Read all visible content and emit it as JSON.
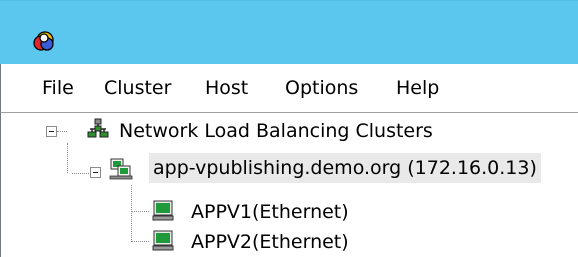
{
  "window": {
    "app_icon": "nlb-manager-icon",
    "titlebar_color": "#5bc7ee"
  },
  "menu": {
    "items": [
      {
        "label": "File"
      },
      {
        "label": "Cluster"
      },
      {
        "label": "Host"
      },
      {
        "label": "Options"
      },
      {
        "label": "Help"
      }
    ]
  },
  "tree": {
    "root": {
      "label": "Network Load Balancing Clusters",
      "icon": "network-clusters-icon",
      "expanded": true
    },
    "cluster": {
      "label": "app-vpublishing.demo.org (172.16.0.13)",
      "icon": "cluster-icon",
      "expanded": true,
      "selected": true
    },
    "hosts": [
      {
        "label": "APPV1(Ethernet)",
        "icon": "host-computer-icon"
      },
      {
        "label": "APPV2(Ethernet)",
        "icon": "host-computer-icon"
      }
    ]
  }
}
